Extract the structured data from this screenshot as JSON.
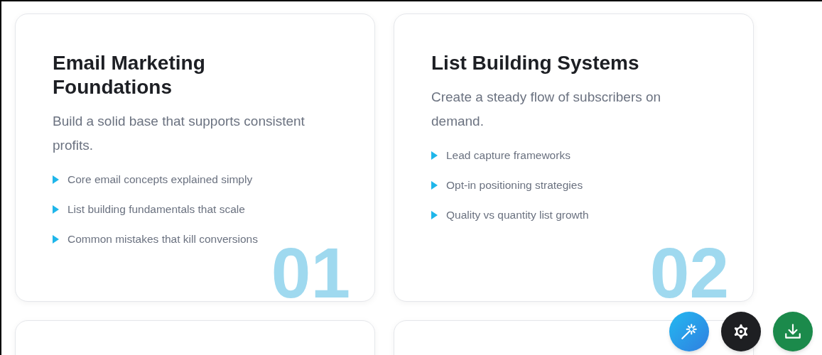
{
  "cards": [
    {
      "number": "01",
      "title": "Email Marketing Foundations",
      "subtitle": "Build a solid base that supports consistent profits.",
      "points": [
        "Core email concepts explained simply",
        "List building fundamentals that scale",
        "Common mistakes that kill conversions"
      ]
    },
    {
      "number": "02",
      "title": "List Building Systems",
      "subtitle": "Create a steady flow of subscribers on demand.",
      "points": [
        "Lead capture frameworks",
        "Opt-in positioning strategies",
        "Quality vs quantity list growth"
      ]
    }
  ],
  "floating_buttons": [
    {
      "kind": "magic"
    },
    {
      "kind": "settings"
    },
    {
      "kind": "download"
    }
  ]
}
